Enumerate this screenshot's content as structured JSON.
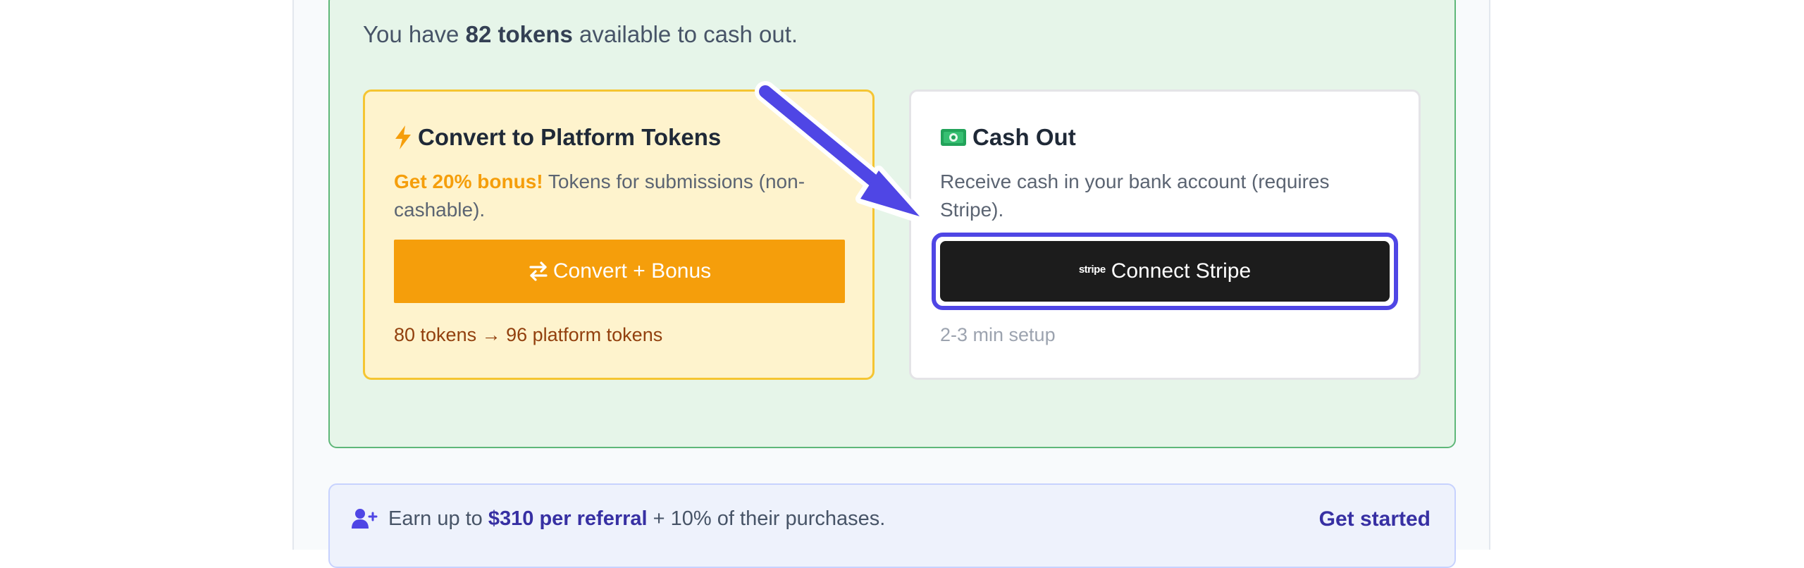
{
  "summary": {
    "prefix": "You have",
    "tokens": "82 tokens",
    "suffix": "available to cash out."
  },
  "convert_card": {
    "icon": "lightning-bolt-icon",
    "title": "Convert to Platform Tokens",
    "bonus": "Get 20% bonus!",
    "desc": "Tokens for submissions (non-cashable).",
    "button_icon": "swap-arrows-icon",
    "button_label": "Convert + Bonus",
    "note": "80 tokens → 96 platform tokens"
  },
  "cashout_card": {
    "icon": "money-bill-icon",
    "title": "Cash Out",
    "desc": "Receive cash in your bank account (requires Stripe).",
    "button_logo": "stripe",
    "button_label": "Connect Stripe",
    "note": "2-3 min setup"
  },
  "referral": {
    "icon": "user-plus-icon",
    "prefix": "Earn up to",
    "amount": "$310 per referral",
    "suffix": "+ 10% of their purchases.",
    "link": "Get started"
  },
  "colors": {
    "accent": "#4f46e5",
    "convert_orange": "#f59e0b",
    "cashout_bg": "#e6f5e9",
    "stripe_button": "#1c1c1c"
  }
}
